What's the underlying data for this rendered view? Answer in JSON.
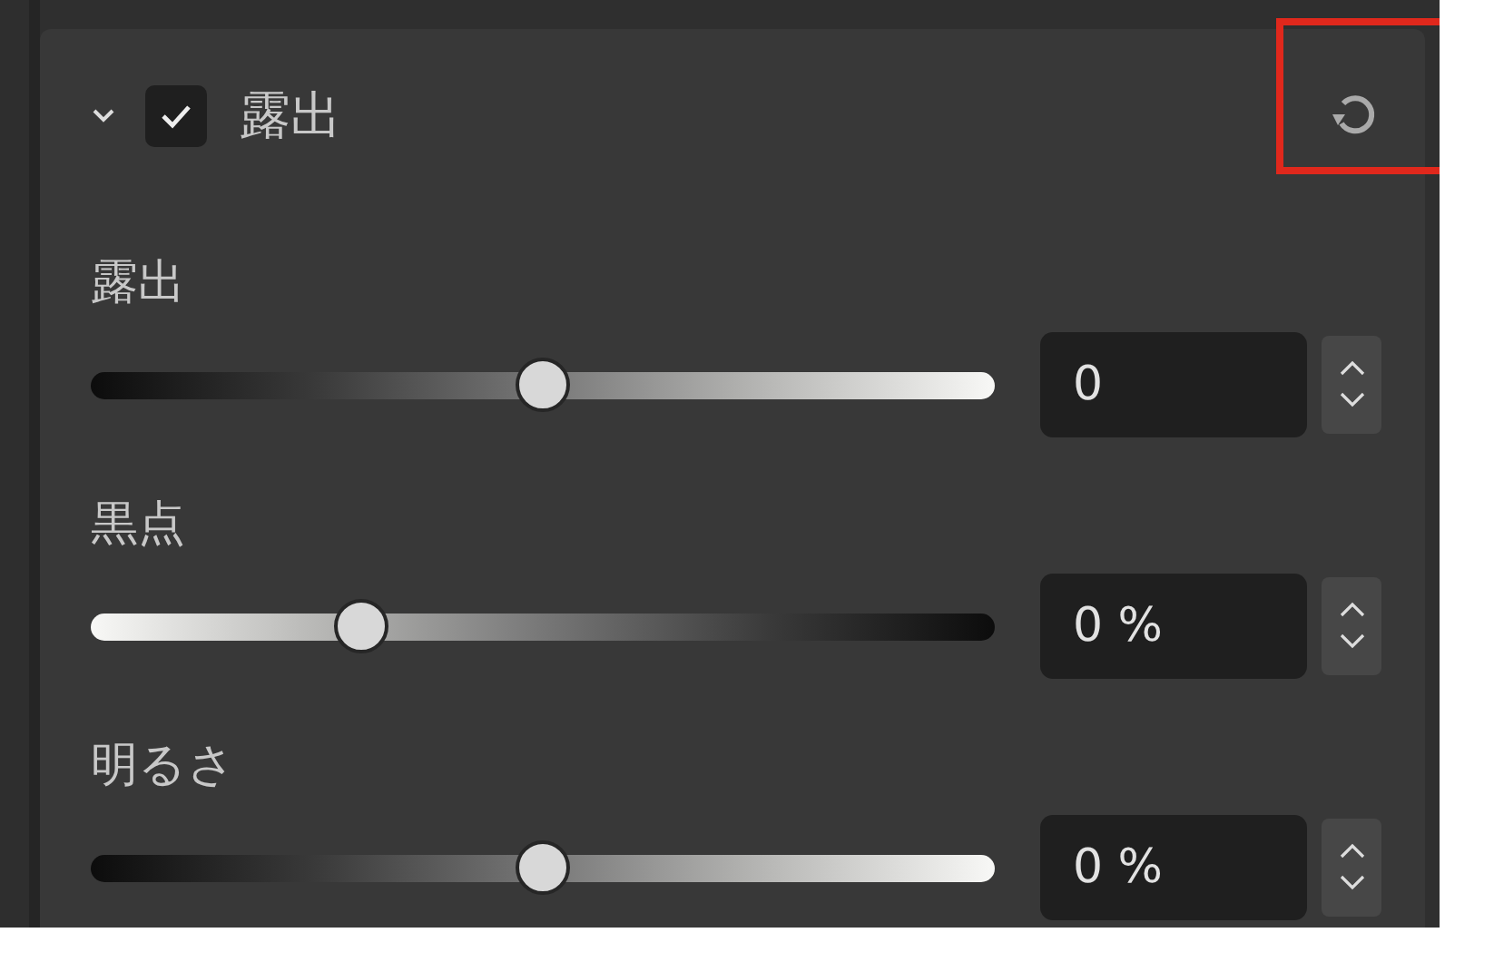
{
  "section": {
    "title": "露出",
    "expanded": true,
    "checked": true,
    "reset_highlighted": true
  },
  "controls": [
    {
      "label": "露出",
      "kind": "dark-light",
      "level": 0.5,
      "value": "0"
    },
    {
      "label": "黒点",
      "kind": "light-dark",
      "level": 0.3,
      "value": "0 %"
    },
    {
      "label": "明るさ",
      "kind": "dark-light",
      "level": 0.5,
      "value": "0 %"
    }
  ]
}
